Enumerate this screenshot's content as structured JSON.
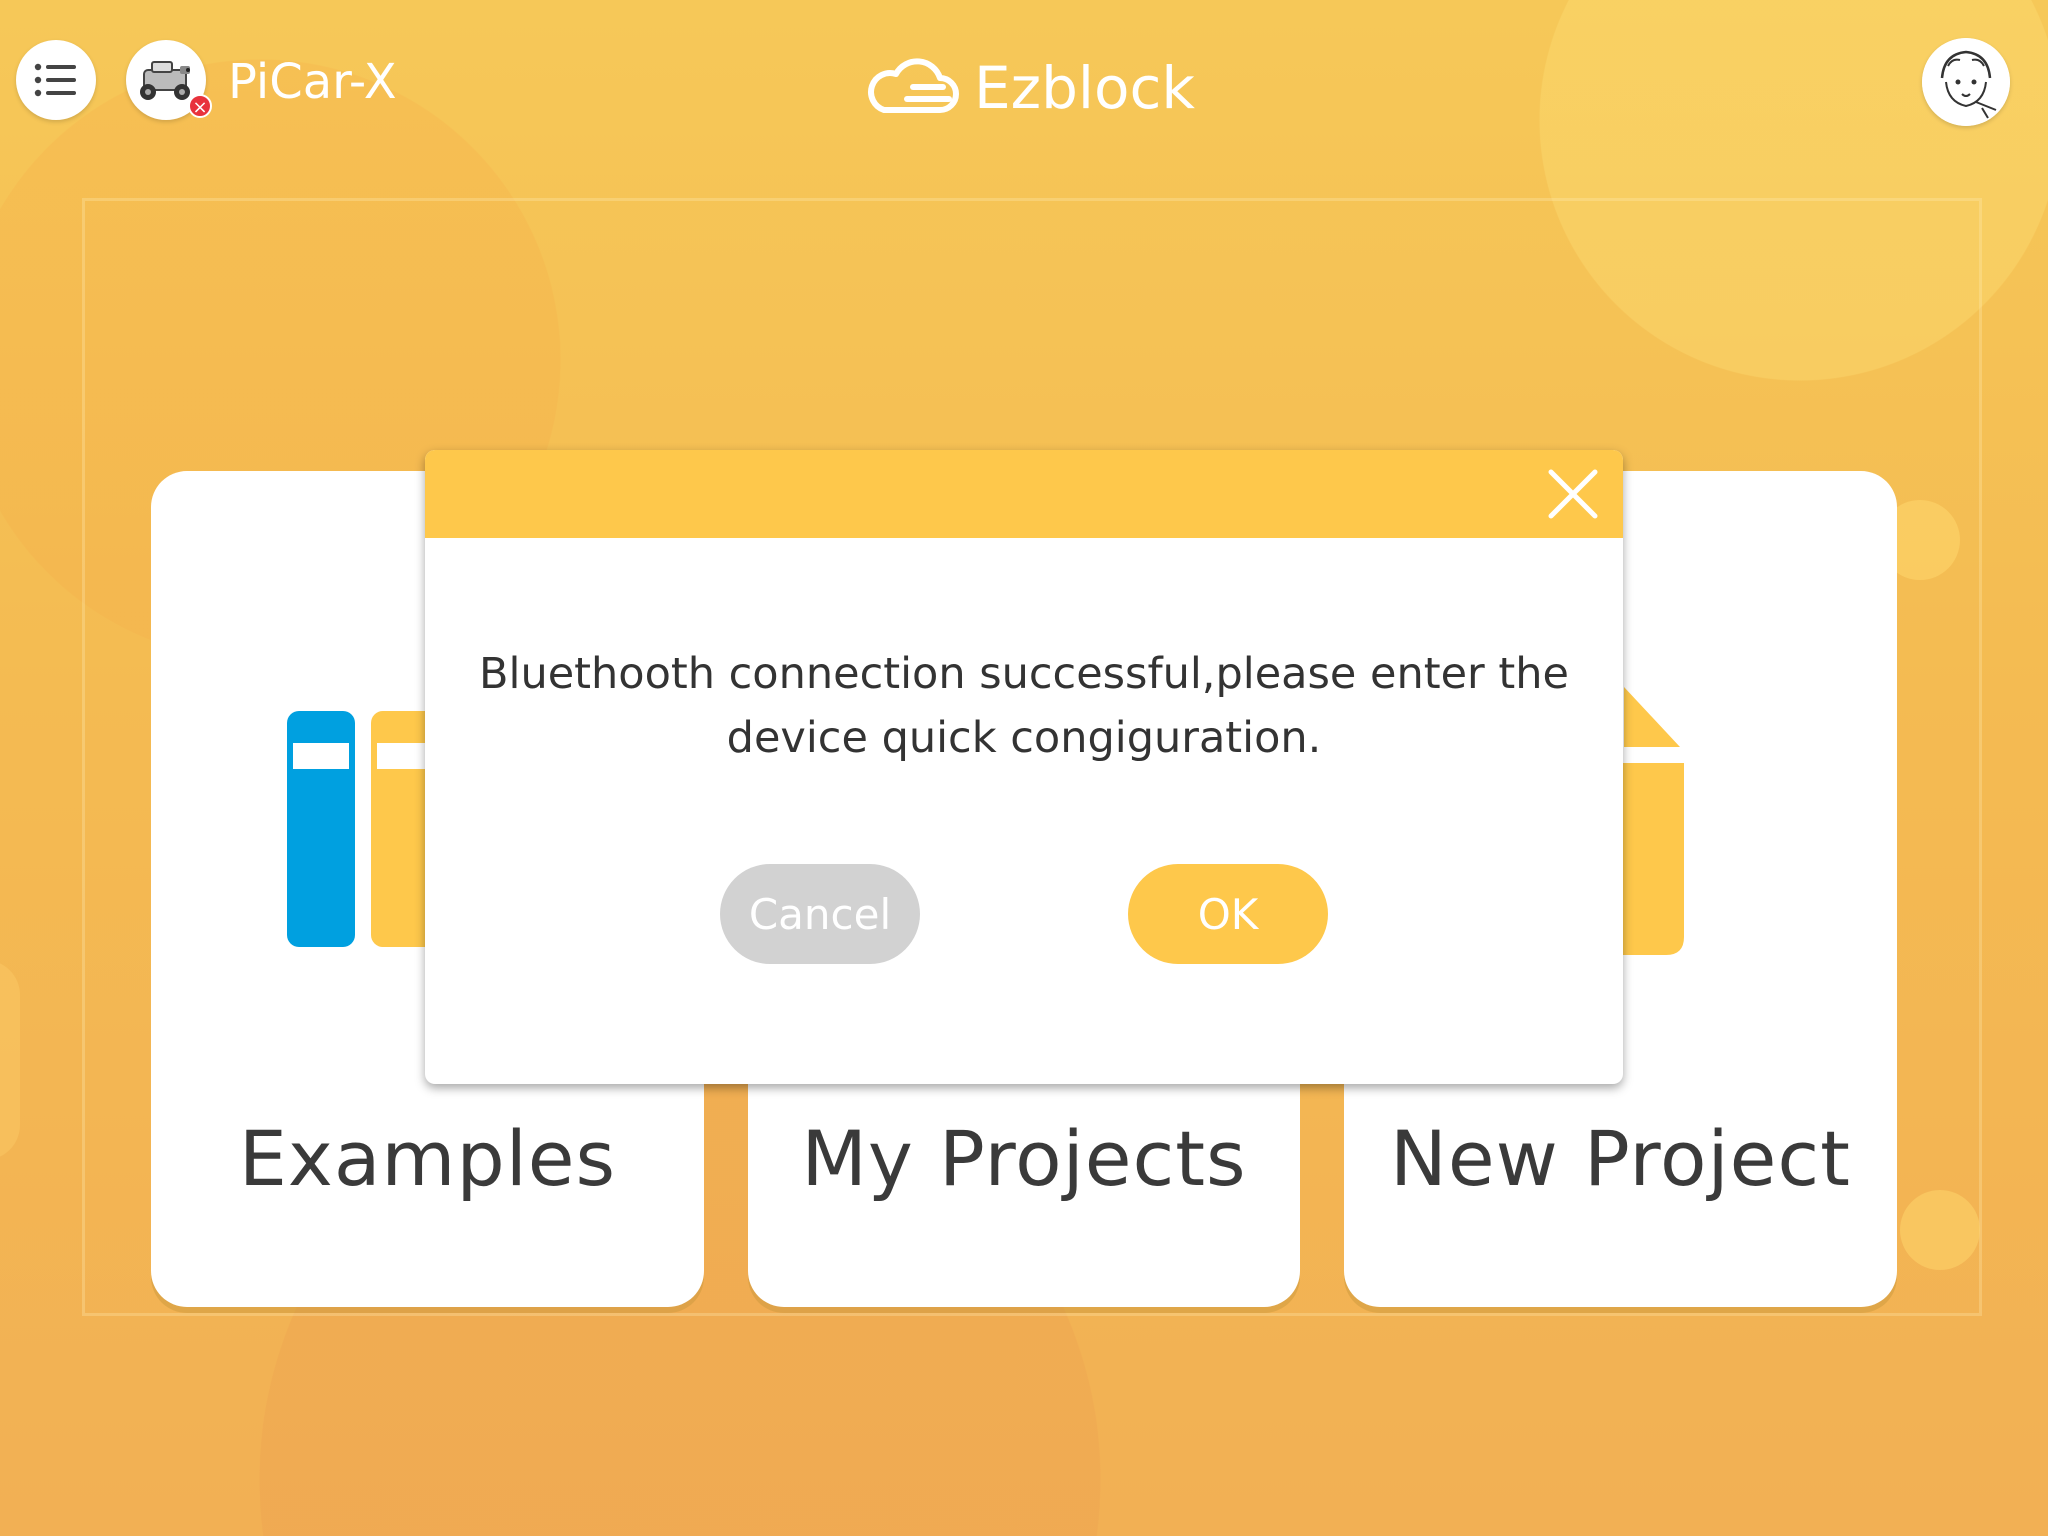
{
  "header": {
    "device_name": "PiCar-X",
    "app_name": "Ezblock",
    "menu_icon": "list-icon",
    "device_status_icon": "error-x-icon"
  },
  "cards": [
    {
      "label": "Examples",
      "icon": "books-icon"
    },
    {
      "label": "My Projects",
      "icon": "folder-icon"
    },
    {
      "label": "New Project",
      "icon": "new-file-icon"
    }
  ],
  "dialog": {
    "message": "Bluethooth connection successful,please enter the device quick congiguration.",
    "cancel_label": "Cancel",
    "ok_label": "OK",
    "close_icon": "close-icon"
  },
  "colors": {
    "accent": "#fec84b",
    "background": "#f4bc4f",
    "book_blue": "#00a0e0",
    "cancel_gray": "#d2d2d2",
    "error_red": "#e8323c"
  }
}
